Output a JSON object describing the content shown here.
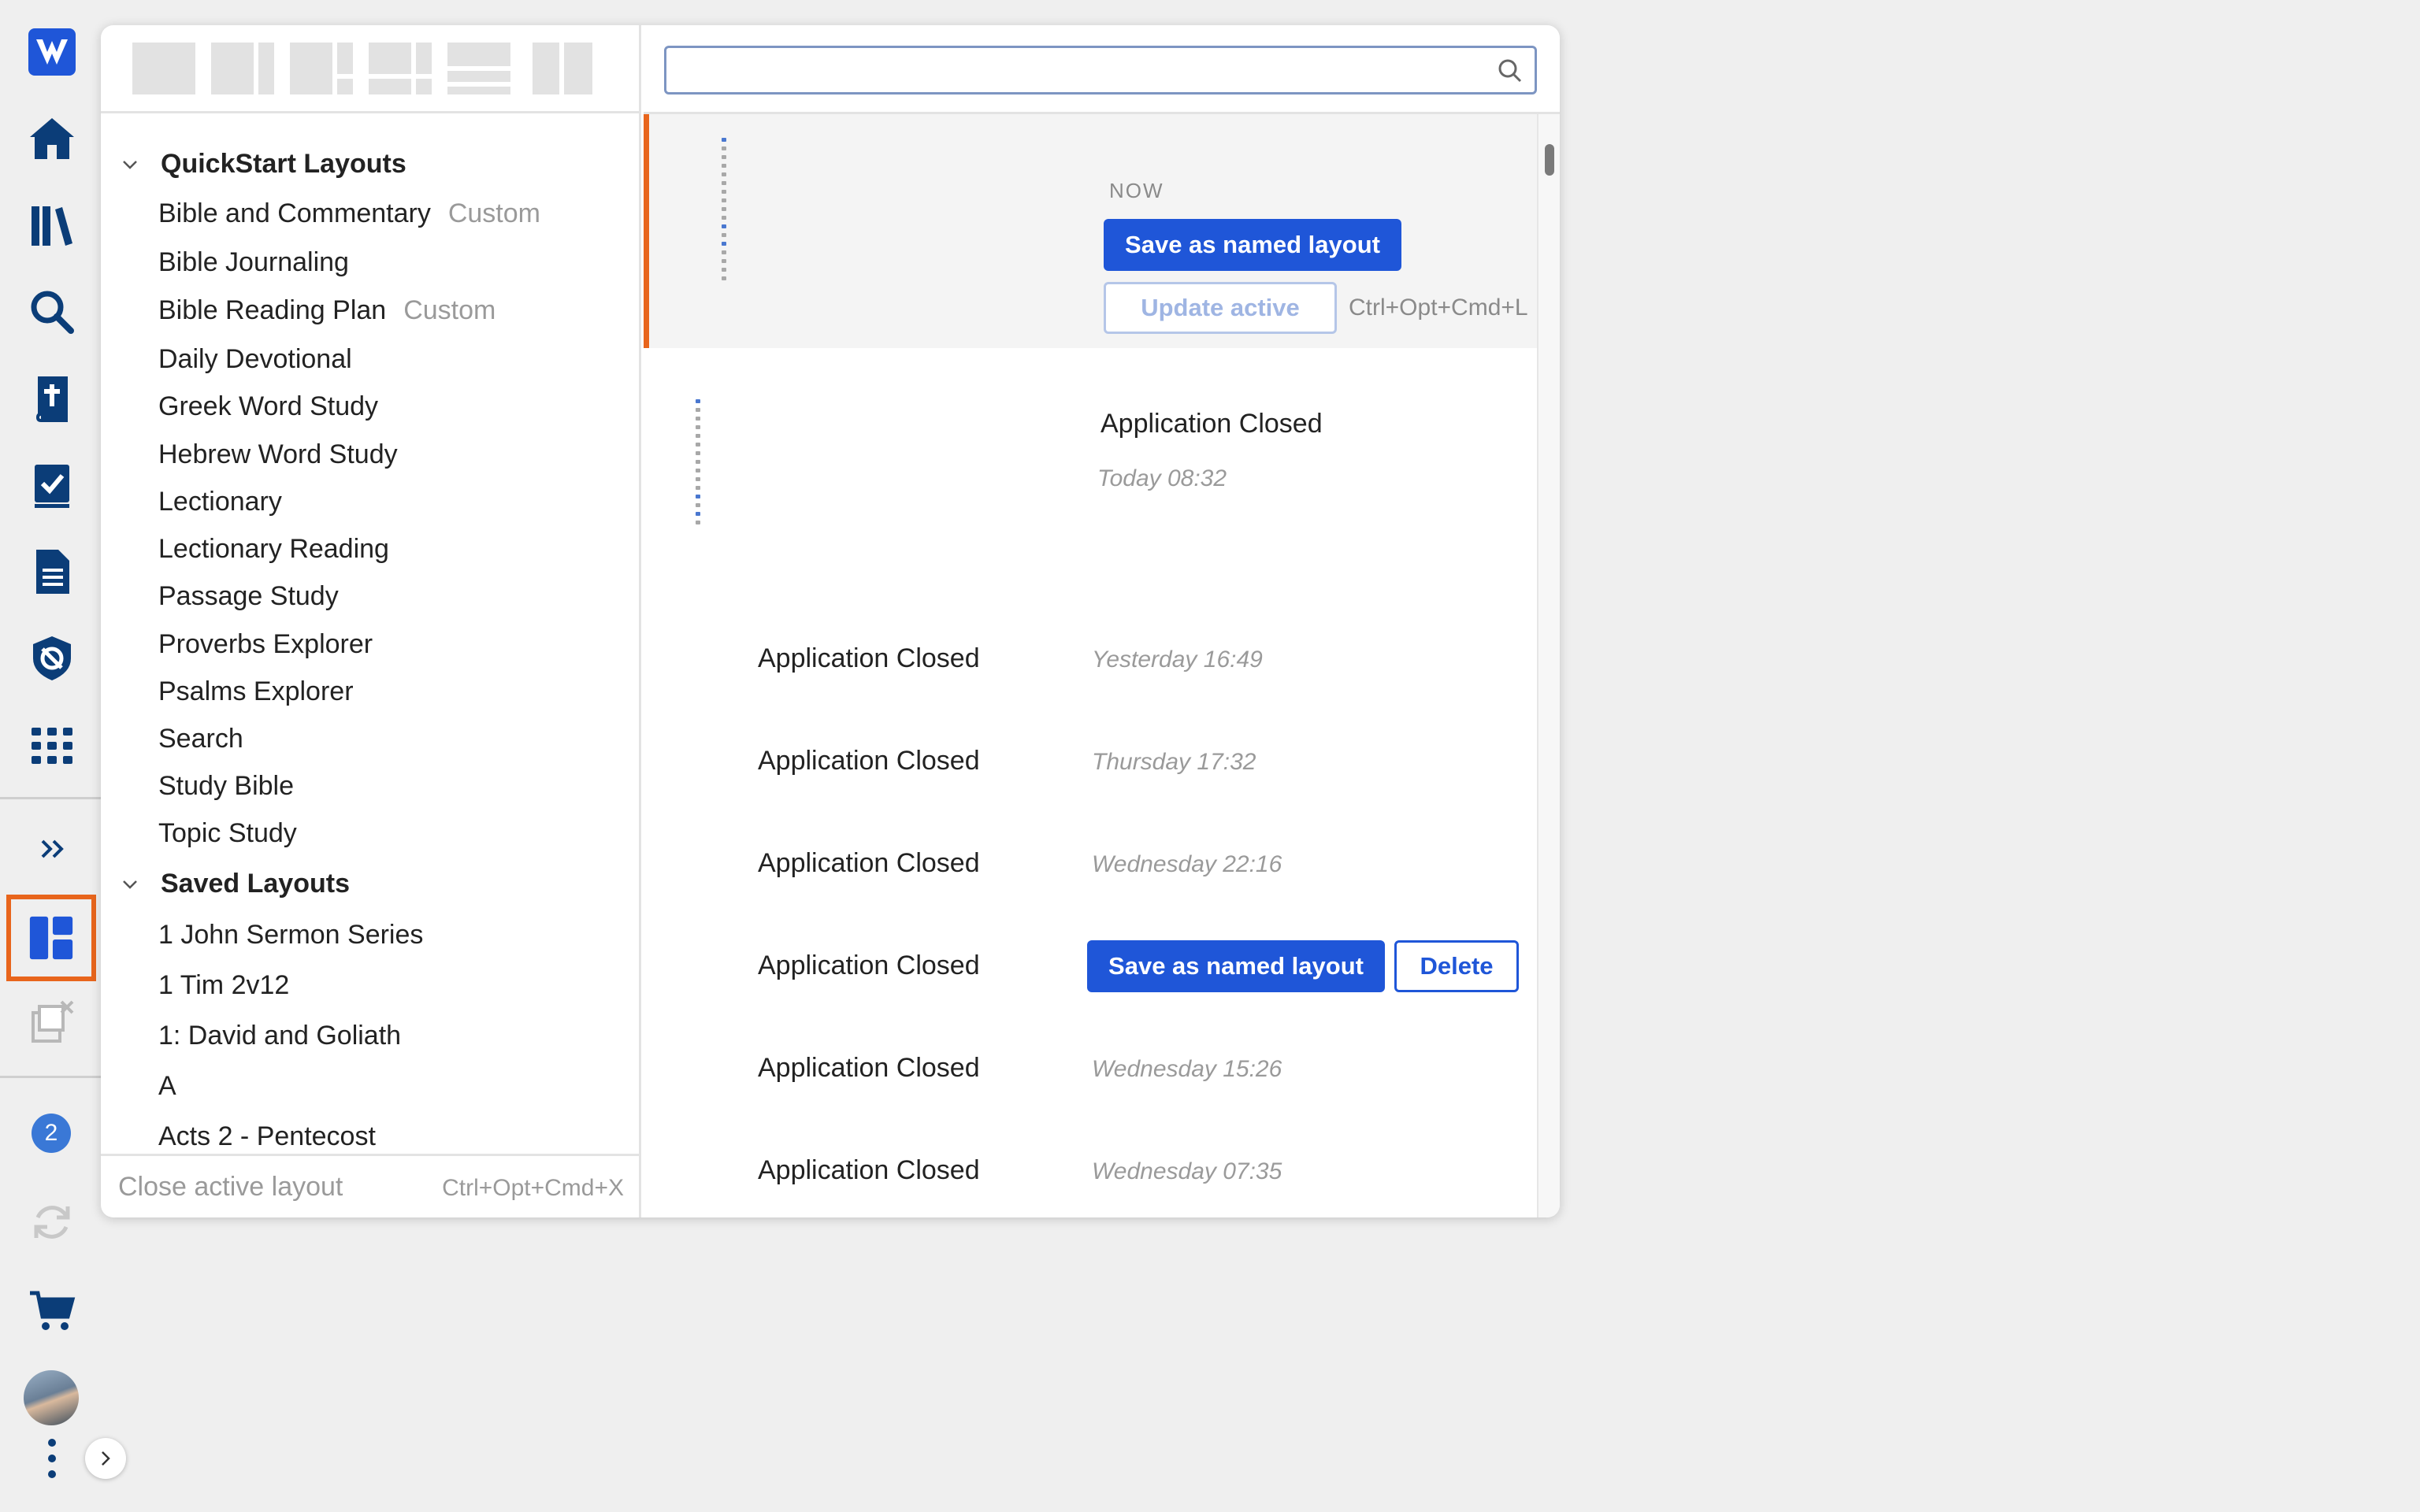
{
  "rail": {
    "icons": [
      "logos-logo-icon",
      "home-icon",
      "library-icon",
      "search-icon",
      "bible-icon",
      "checklist-icon",
      "document-icon",
      "shield-icon",
      "apps-grid-icon",
      "expand-icon",
      "layouts-icon",
      "close-layouts-icon",
      "sync-icon",
      "cart-icon",
      "more-icon",
      "collapse-chevron-icon"
    ],
    "notification_count": "2"
  },
  "colors": {
    "accent": "#e8651c",
    "primary": "#1f56d8"
  },
  "quickstart": {
    "header": "QuickStart Layouts",
    "items": [
      {
        "label": "Bible and Commentary",
        "tag": "Custom"
      },
      {
        "label": "Bible Journaling",
        "tag": ""
      },
      {
        "label": "Bible Reading Plan",
        "tag": "Custom"
      },
      {
        "label": "Daily Devotional",
        "tag": ""
      },
      {
        "label": "Greek Word Study",
        "tag": ""
      },
      {
        "label": "Hebrew Word Study",
        "tag": ""
      },
      {
        "label": "Lectionary",
        "tag": ""
      },
      {
        "label": "Lectionary Reading",
        "tag": ""
      },
      {
        "label": "Passage Study",
        "tag": ""
      },
      {
        "label": "Proverbs Explorer",
        "tag": ""
      },
      {
        "label": "Psalms Explorer",
        "tag": ""
      },
      {
        "label": "Search",
        "tag": ""
      },
      {
        "label": "Study Bible",
        "tag": ""
      },
      {
        "label": "Topic Study",
        "tag": ""
      }
    ]
  },
  "saved": {
    "header": "Saved Layouts",
    "items": [
      "1 John Sermon Series",
      "1 Tim 2v12",
      "1: David and Goliath",
      "A",
      "Acts 2 - Pentecost"
    ]
  },
  "footer": {
    "close_label": "Close active layout",
    "close_shortcut": "Ctrl+Opt+Cmd+X"
  },
  "search": {
    "value": "",
    "placeholder": ""
  },
  "now": {
    "label": "NOW",
    "save_button": "Save as named layout",
    "update_button": "Update active",
    "update_shortcut": "Ctrl+Opt+Cmd+L"
  },
  "history": [
    {
      "title": "Application Closed",
      "time": "Today 08:32"
    },
    {
      "title": "Application Closed",
      "time": "Yesterday 16:49"
    },
    {
      "title": "Application Closed",
      "time": "Thursday 17:32"
    },
    {
      "title": "Application Closed",
      "time": "Wednesday 22:16"
    },
    {
      "title": "Application Closed",
      "time": "",
      "save_button": "Save as named layout",
      "delete_button": "Delete"
    },
    {
      "title": "Application Closed",
      "time": "Wednesday 15:26"
    },
    {
      "title": "Application Closed",
      "time": "Wednesday 07:35"
    }
  ]
}
